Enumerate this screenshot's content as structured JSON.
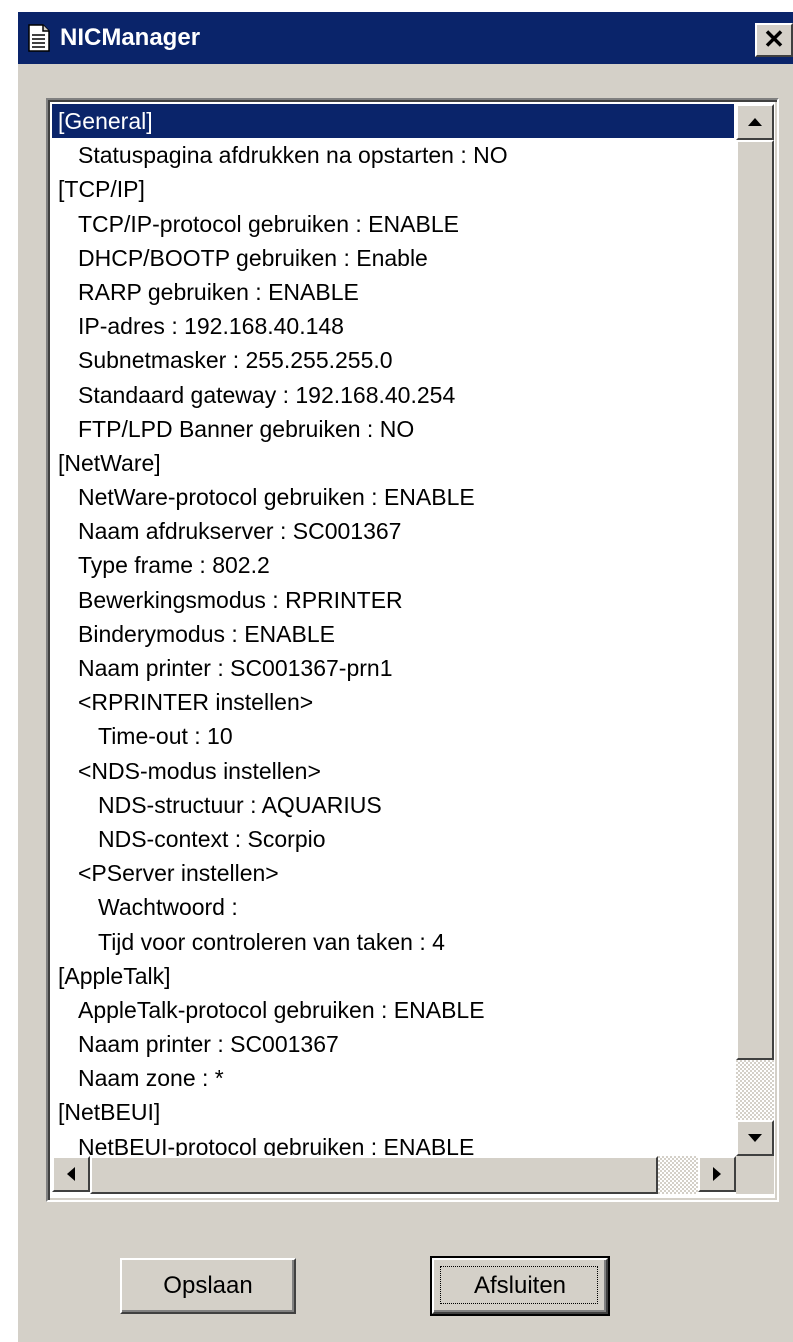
{
  "window": {
    "title": "NICManager",
    "title_icon": "document-icon",
    "close_glyph": "✕"
  },
  "list": {
    "selected_index": 0,
    "items": [
      {
        "text": "[General]",
        "level": 0
      },
      {
        "text": "Statuspagina afdrukken na opstarten : NO",
        "level": 1
      },
      {
        "text": "[TCP/IP]",
        "level": 0
      },
      {
        "text": "TCP/IP-protocol gebruiken : ENABLE",
        "level": 1
      },
      {
        "text": "DHCP/BOOTP gebruiken : Enable",
        "level": 1
      },
      {
        "text": "RARP gebruiken : ENABLE",
        "level": 1
      },
      {
        "text": "IP-adres : 192.168.40.148",
        "level": 1
      },
      {
        "text": "Subnetmasker : 255.255.255.0",
        "level": 1
      },
      {
        "text": "Standaard gateway : 192.168.40.254",
        "level": 1
      },
      {
        "text": "FTP/LPD Banner gebruiken : NO",
        "level": 1
      },
      {
        "text": "[NetWare]",
        "level": 0
      },
      {
        "text": "NetWare-protocol gebruiken : ENABLE",
        "level": 1
      },
      {
        "text": "Naam afdrukserver : SC001367",
        "level": 1
      },
      {
        "text": "Type frame : 802.2",
        "level": 1
      },
      {
        "text": "Bewerkingsmodus : RPRINTER",
        "level": 1
      },
      {
        "text": "Binderymodus : ENABLE",
        "level": 1
      },
      {
        "text": "Naam printer : SC001367-prn1",
        "level": 1
      },
      {
        "text": "<RPRINTER instellen>",
        "level": 1
      },
      {
        "text": "Time-out : 10",
        "level": 2
      },
      {
        "text": "<NDS-modus instellen>",
        "level": 1
      },
      {
        "text": "NDS-structuur : AQUARIUS",
        "level": 2
      },
      {
        "text": "NDS-context : Scorpio",
        "level": 2
      },
      {
        "text": "<PServer instellen>",
        "level": 1
      },
      {
        "text": "Wachtwoord :",
        "level": 2
      },
      {
        "text": "Tijd voor controleren van taken : 4",
        "level": 2
      },
      {
        "text": "[AppleTalk]",
        "level": 0
      },
      {
        "text": "AppleTalk-protocol gebruiken : ENABLE",
        "level": 1
      },
      {
        "text": "Naam printer : SC001367",
        "level": 1
      },
      {
        "text": "Naam zone : *",
        "level": 1
      },
      {
        "text": "[NetBEUI]",
        "level": 0
      },
      {
        "text": "NetBEUI-protocol gebruiken : ENABLE",
        "level": 1
      }
    ]
  },
  "buttons": {
    "save_label": "Opslaan",
    "close_label": "Afsluiten"
  },
  "colors": {
    "titlebar": "#0a246a",
    "face": "#d4d0c8",
    "selection": "#0a246a"
  }
}
